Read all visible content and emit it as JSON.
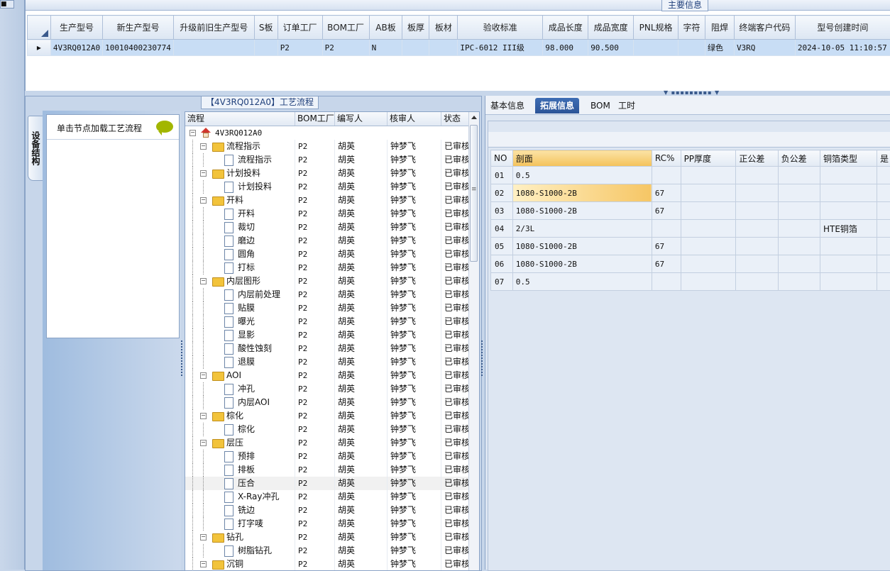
{
  "top": {
    "title": "主要信息",
    "columns": [
      "生产型号",
      "新生产型号",
      "升级前旧生产型号",
      "S板",
      "订单工厂",
      "BOM工厂",
      "AB板",
      "板厚",
      "板材",
      "验收标准",
      "成品长度",
      "成品宽度",
      "PNL规格",
      "字符",
      "阻焊",
      "终端客户代码",
      "型号创建时间"
    ],
    "row": [
      "4V3RQ012A0",
      "10010400230774",
      "",
      "",
      "P2",
      "P2",
      "N",
      "",
      "",
      "IPC-6012 III级",
      "98.000",
      "90.500",
      "",
      "",
      "绿色",
      "V3RQ",
      "2024-10-05 11:10:57"
    ]
  },
  "left": {
    "tab_label": "设备结构",
    "button_label": "单击节点加载工艺流程",
    "panel_title": "【4V3RQ012A0】工艺流程"
  },
  "process": {
    "headers": [
      "流程",
      "BOM工厂",
      "编写人",
      "核审人",
      "状态"
    ],
    "root": "4V3RQ012A0",
    "rows": [
      {
        "name": "流程指示",
        "type": "folder",
        "bom": "P2",
        "writer": "胡英",
        "reviewer": "钟梦飞",
        "status": "已审核"
      },
      {
        "name": "流程指示",
        "type": "doc",
        "bom": "P2",
        "writer": "胡英",
        "reviewer": "钟梦飞",
        "status": "已审核"
      },
      {
        "name": "计划投料",
        "type": "folder",
        "bom": "P2",
        "writer": "胡英",
        "reviewer": "钟梦飞",
        "status": "已审核"
      },
      {
        "name": "计划投料",
        "type": "doc",
        "bom": "P2",
        "writer": "胡英",
        "reviewer": "钟梦飞",
        "status": "已审核"
      },
      {
        "name": "开料",
        "type": "folder",
        "bom": "P2",
        "writer": "胡英",
        "reviewer": "钟梦飞",
        "status": "已审核"
      },
      {
        "name": "开料",
        "type": "doc",
        "bom": "P2",
        "writer": "胡英",
        "reviewer": "钟梦飞",
        "status": "已审核"
      },
      {
        "name": "裁切",
        "type": "doc",
        "bom": "P2",
        "writer": "胡英",
        "reviewer": "钟梦飞",
        "status": "已审核"
      },
      {
        "name": "磨边",
        "type": "doc",
        "bom": "P2",
        "writer": "胡英",
        "reviewer": "钟梦飞",
        "status": "已审核"
      },
      {
        "name": "圆角",
        "type": "doc",
        "bom": "P2",
        "writer": "胡英",
        "reviewer": "钟梦飞",
        "status": "已审核"
      },
      {
        "name": "打标",
        "type": "doc",
        "bom": "P2",
        "writer": "胡英",
        "reviewer": "钟梦飞",
        "status": "已审核"
      },
      {
        "name": "内层图形",
        "type": "folder",
        "bom": "P2",
        "writer": "胡英",
        "reviewer": "钟梦飞",
        "status": "已审核"
      },
      {
        "name": "内层前处理",
        "type": "doc",
        "bom": "P2",
        "writer": "胡英",
        "reviewer": "钟梦飞",
        "status": "已审核"
      },
      {
        "name": "贴膜",
        "type": "doc",
        "bom": "P2",
        "writer": "胡英",
        "reviewer": "钟梦飞",
        "status": "已审核"
      },
      {
        "name": "曝光",
        "type": "doc",
        "bom": "P2",
        "writer": "胡英",
        "reviewer": "钟梦飞",
        "status": "已审核"
      },
      {
        "name": "显影",
        "type": "doc",
        "bom": "P2",
        "writer": "胡英",
        "reviewer": "钟梦飞",
        "status": "已审核"
      },
      {
        "name": "酸性蚀刻",
        "type": "doc",
        "bom": "P2",
        "writer": "胡英",
        "reviewer": "钟梦飞",
        "status": "已审核"
      },
      {
        "name": "退膜",
        "type": "doc",
        "bom": "P2",
        "writer": "胡英",
        "reviewer": "钟梦飞",
        "status": "已审核"
      },
      {
        "name": "AOI",
        "type": "folder",
        "bom": "P2",
        "writer": "胡英",
        "reviewer": "钟梦飞",
        "status": "已审核"
      },
      {
        "name": "冲孔",
        "type": "doc",
        "bom": "P2",
        "writer": "胡英",
        "reviewer": "钟梦飞",
        "status": "已审核"
      },
      {
        "name": "内层AOI",
        "type": "doc",
        "bom": "P2",
        "writer": "胡英",
        "reviewer": "钟梦飞",
        "status": "已审核"
      },
      {
        "name": "棕化",
        "type": "folder",
        "bom": "P2",
        "writer": "胡英",
        "reviewer": "钟梦飞",
        "status": "已审核"
      },
      {
        "name": "棕化",
        "type": "doc",
        "bom": "P2",
        "writer": "胡英",
        "reviewer": "钟梦飞",
        "status": "已审核"
      },
      {
        "name": "层压",
        "type": "folder",
        "bom": "P2",
        "writer": "胡英",
        "reviewer": "钟梦飞",
        "status": "已审核"
      },
      {
        "name": "预排",
        "type": "doc",
        "bom": "P2",
        "writer": "胡英",
        "reviewer": "钟梦飞",
        "status": "已审核"
      },
      {
        "name": "排板",
        "type": "doc",
        "bom": "P2",
        "writer": "胡英",
        "reviewer": "钟梦飞",
        "status": "已审核"
      },
      {
        "name": "压合",
        "type": "doc",
        "bom": "P2",
        "writer": "胡英",
        "reviewer": "钟梦飞",
        "status": "已审核",
        "selected": true
      },
      {
        "name": "X-Ray冲孔",
        "type": "doc",
        "bom": "P2",
        "writer": "胡英",
        "reviewer": "钟梦飞",
        "status": "已审核"
      },
      {
        "name": "铣边",
        "type": "doc",
        "bom": "P2",
        "writer": "胡英",
        "reviewer": "钟梦飞",
        "status": "已审核"
      },
      {
        "name": "打字唛",
        "type": "doc",
        "bom": "P2",
        "writer": "胡英",
        "reviewer": "钟梦飞",
        "status": "已审核"
      },
      {
        "name": "钻孔",
        "type": "folder",
        "bom": "P2",
        "writer": "胡英",
        "reviewer": "钟梦飞",
        "status": "已审核"
      },
      {
        "name": "树脂钻孔",
        "type": "doc",
        "bom": "P2",
        "writer": "胡英",
        "reviewer": "钟梦飞",
        "status": "已审核"
      },
      {
        "name": "沉铜",
        "type": "folder",
        "bom": "P2",
        "writer": "胡英",
        "reviewer": "钟梦飞",
        "status": "已审核"
      }
    ]
  },
  "right": {
    "tabs": [
      "基本信息",
      "拓展信息",
      "BOM",
      "工时"
    ],
    "active_tab": "拓展信息",
    "grid_headers": [
      "NO",
      "剖面",
      "RC%",
      "PP厚度",
      "正公差",
      "负公差",
      "铜箔类型",
      "是"
    ],
    "grid_rows": [
      {
        "no": "01",
        "section": "0.5",
        "rc": "",
        "pp": "",
        "pos": "",
        "neg": "",
        "cu": ""
      },
      {
        "no": "02",
        "section": "1080-S1000-2B",
        "rc": "67",
        "pp": "",
        "pos": "",
        "neg": "",
        "cu": ""
      },
      {
        "no": "03",
        "section": "1080-S1000-2B",
        "rc": "67",
        "pp": "",
        "pos": "",
        "neg": "",
        "cu": ""
      },
      {
        "no": "04",
        "section": "2/3L",
        "rc": "",
        "pp": "",
        "pos": "",
        "neg": "",
        "cu": "HTE铜箔"
      },
      {
        "no": "05",
        "section": "1080-S1000-2B",
        "rc": "67",
        "pp": "",
        "pos": "",
        "neg": "",
        "cu": ""
      },
      {
        "no": "06",
        "section": "1080-S1000-2B",
        "rc": "67",
        "pp": "",
        "pos": "",
        "neg": "",
        "cu": ""
      },
      {
        "no": "07",
        "section": "0.5",
        "rc": "",
        "pp": "",
        "pos": "",
        "neg": "",
        "cu": ""
      }
    ]
  },
  "colors": {
    "accent": "#2b5497",
    "selected_row": "#c8ddf5",
    "selection_orange": "#f6c665",
    "folder": "#f2c33b"
  }
}
